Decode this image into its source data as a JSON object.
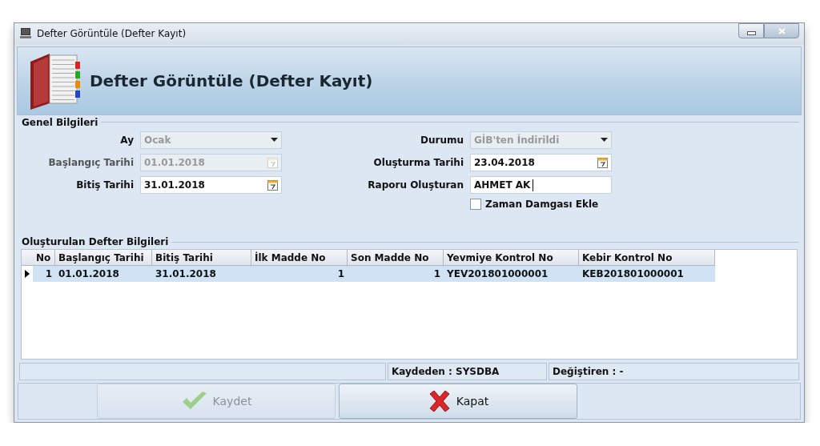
{
  "window": {
    "title": "Defter Görüntüle (Defter Kayıt)"
  },
  "header": {
    "title": "Defter Görüntüle (Defter Kayıt)"
  },
  "general": {
    "title": "Genel Bilgileri",
    "left_fields": [
      {
        "label": "Ay",
        "kind": "dropdown",
        "value": "Ocak",
        "disabled": true
      },
      {
        "label": "Başlangıç Tarihi",
        "kind": "date",
        "value": "01.01.2018",
        "disabled": true
      },
      {
        "label": "Bitiş Tarihi",
        "kind": "date",
        "value": "31.01.2018",
        "disabled": false
      }
    ],
    "right_fields": [
      {
        "label": "Durumu",
        "kind": "dropdown",
        "value": "GİB'ten İndirildi",
        "disabled": true
      },
      {
        "label": "Oluşturma Tarihi",
        "kind": "date",
        "value": "23.04.2018",
        "disabled": false
      },
      {
        "label": "Raporu Oluşturan",
        "kind": "text",
        "value": "AHMET AK",
        "disabled": false
      }
    ],
    "checkbox": {
      "label": "Zaman Damgası Ekle",
      "checked": false
    }
  },
  "grid": {
    "title": "Oluşturulan Defter Bilgileri",
    "columns": [
      "No",
      "Başlangıç Tarihi",
      "Bitiş Tarihi",
      "İlk Madde No",
      "Son Madde No",
      "Yevmiye Kontrol No",
      "Kebir Kontrol No"
    ],
    "rows": [
      {
        "selected": true,
        "cells": [
          "1",
          "01.01.2018",
          "31.01.2018",
          "1",
          "1",
          "YEV201801000001",
          "KEB201801000001"
        ]
      }
    ]
  },
  "status_bar": {
    "saved_by": "Kaydeden : SYSDBA",
    "changed_by": "Değiştiren :  -"
  },
  "buttons": [
    {
      "label": "Kaydet",
      "kind": "save",
      "disabled": true
    },
    {
      "label": "Kapat",
      "kind": "close",
      "disabled": false
    }
  ]
}
